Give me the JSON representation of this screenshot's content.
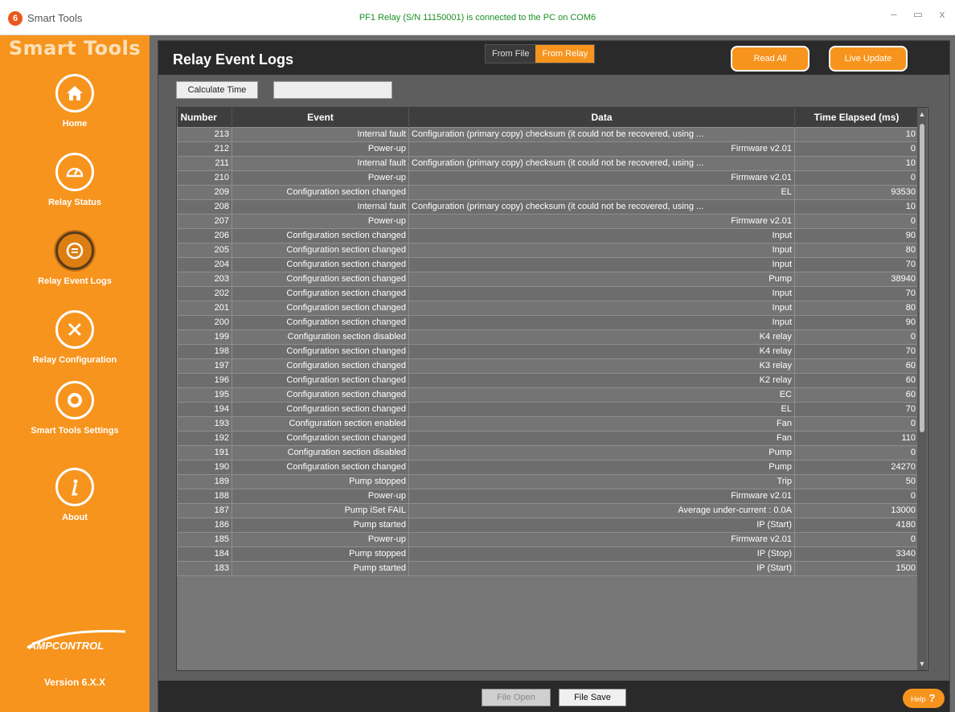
{
  "window": {
    "app_name": "Smart Tools",
    "icon_glyph": "6",
    "status": "PF1 Relay (S/N 11150001) is connected to the PC on COM6",
    "controls": {
      "minimize": "–",
      "maximize": "▭",
      "close": "x"
    }
  },
  "sidebar": {
    "brand": "Smart Tools",
    "items": [
      {
        "label": "Home",
        "icon": "home-icon"
      },
      {
        "label": "Relay Status",
        "icon": "gauge-icon"
      },
      {
        "label": "Relay Event Logs",
        "icon": "event-log-icon",
        "active": true
      },
      {
        "label": "Relay Configuration",
        "icon": "tools-icon"
      },
      {
        "label": "Smart Tools Settings",
        "icon": "gear-icon"
      },
      {
        "label": "About",
        "icon": "info-icon"
      }
    ],
    "logo": "AMPCONTROL",
    "version": "Version 6.X.X"
  },
  "header": {
    "title": "Relay Event Logs",
    "source_file": "From File",
    "source_relay": "From Relay",
    "read_all": "Read All",
    "live_update": "Live Update"
  },
  "toolbar": {
    "calculate_time": "Calculate Time",
    "time_value": ""
  },
  "table": {
    "columns": [
      "Number",
      "Event",
      "Data",
      "Time Elapsed (ms)"
    ],
    "rows": [
      [
        "213",
        "Internal fault",
        "Configuration (primary copy) checksum (it could not be recovered, using ...",
        "10"
      ],
      [
        "212",
        "Power-up",
        "Firmware v2.01",
        "0"
      ],
      [
        "211",
        "Internal fault",
        "Configuration (primary copy) checksum (it could not be recovered, using ...",
        "10"
      ],
      [
        "210",
        "Power-up",
        "Firmware v2.01",
        "0"
      ],
      [
        "209",
        "Configuration section changed",
        "EL",
        "93530"
      ],
      [
        "208",
        "Internal fault",
        "Configuration (primary copy) checksum (it could not be recovered, using ...",
        "10"
      ],
      [
        "207",
        "Power-up",
        "Firmware v2.01",
        "0"
      ],
      [
        "206",
        "Configuration section changed",
        "Input",
        "90"
      ],
      [
        "205",
        "Configuration section changed",
        "Input",
        "80"
      ],
      [
        "204",
        "Configuration section changed",
        "Input",
        "70"
      ],
      [
        "203",
        "Configuration section changed",
        "Pump",
        "38940"
      ],
      [
        "202",
        "Configuration section changed",
        "Input",
        "70"
      ],
      [
        "201",
        "Configuration section changed",
        "Input",
        "80"
      ],
      [
        "200",
        "Configuration section changed",
        "Input",
        "90"
      ],
      [
        "199",
        "Configuration section disabled",
        "K4 relay",
        "0"
      ],
      [
        "198",
        "Configuration section changed",
        "K4 relay",
        "70"
      ],
      [
        "197",
        "Configuration section changed",
        "K3 relay",
        "60"
      ],
      [
        "196",
        "Configuration section changed",
        "K2 relay",
        "60"
      ],
      [
        "195",
        "Configuration section changed",
        "EC",
        "60"
      ],
      [
        "194",
        "Configuration section changed",
        "EL",
        "70"
      ],
      [
        "193",
        "Configuration section enabled",
        "Fan",
        "0"
      ],
      [
        "192",
        "Configuration section changed",
        "Fan",
        "110"
      ],
      [
        "191",
        "Configuration section disabled",
        "Pump",
        "0"
      ],
      [
        "190",
        "Configuration section changed",
        "Pump",
        "24270"
      ],
      [
        "189",
        "Pump stopped",
        "Trip",
        "50"
      ],
      [
        "188",
        "Power-up",
        "Firmware v2.01",
        "0"
      ],
      [
        "187",
        "Pump iSet FAIL",
        "Average under-current : 0.0A",
        "13000"
      ],
      [
        "186",
        "Pump started",
        "IP (Start)",
        "4180"
      ],
      [
        "185",
        "Power-up",
        "Firmware v2.01",
        "0"
      ],
      [
        "184",
        "Pump stopped",
        "IP (Stop)",
        "3340"
      ],
      [
        "183",
        "Pump started",
        "IP (Start)",
        "1500"
      ]
    ]
  },
  "footer": {
    "file_open": "File Open",
    "file_save": "File Save",
    "help": "Help",
    "help_glyph": "?"
  },
  "colors": {
    "accent": "#f7941d",
    "status_text": "#1a8f24",
    "header_bg": "#2a2a2a",
    "grid_bg": "#747474"
  }
}
